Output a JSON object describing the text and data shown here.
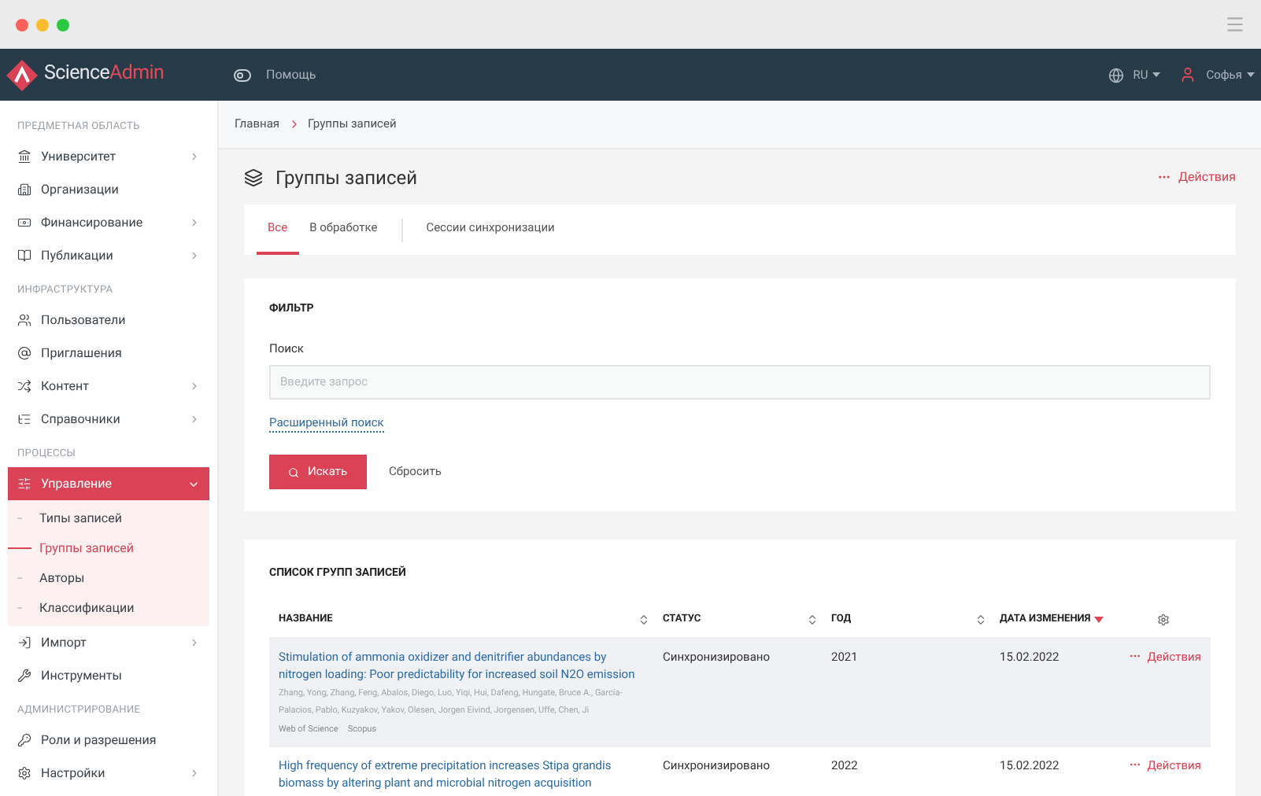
{
  "brand": {
    "name_part_1": "Science",
    "name_part_2": "Admin"
  },
  "header": {
    "help": "Помощь",
    "language": "RU",
    "user": "Софья"
  },
  "sidebar": {
    "sections": [
      {
        "title": "ПРЕДМЕТНАЯ ОБЛАСТЬ",
        "items": [
          {
            "label": "Университет",
            "has_submenu": true,
            "selected": false,
            "expanded": false
          },
          {
            "label": "Организации",
            "has_submenu": false,
            "selected": false
          },
          {
            "label": "Финансирование",
            "has_submenu": true,
            "selected": false,
            "expanded": false
          },
          {
            "label": "Публикации",
            "has_submenu": true,
            "selected": false,
            "expanded": false
          }
        ]
      },
      {
        "title": "ИНФРАСТРУКТУРА",
        "items": [
          {
            "label": "Пользователи",
            "has_submenu": false,
            "selected": false
          },
          {
            "label": "Приглашения",
            "has_submenu": false,
            "selected": false
          },
          {
            "label": "Контент",
            "has_submenu": true,
            "selected": false,
            "expanded": false
          },
          {
            "label": "Справочники",
            "has_submenu": true,
            "selected": false,
            "expanded": false
          }
        ]
      },
      {
        "title": "ПРОЦЕССЫ",
        "items": [
          {
            "label": "Управление",
            "has_submenu": true,
            "selected": true,
            "expanded": true,
            "children": [
              {
                "label": "Типы записей",
                "selected": false
              },
              {
                "label": "Группы записей",
                "selected": true
              },
              {
                "label": "Авторы",
                "selected": false
              },
              {
                "label": "Классификации",
                "selected": false
              }
            ]
          },
          {
            "label": "Импорт",
            "has_submenu": true,
            "selected": false,
            "expanded": false
          },
          {
            "label": "Инструменты",
            "has_submenu": false,
            "selected": false
          }
        ]
      },
      {
        "title": "АДМИНИСТРИРОВАНИЕ",
        "items": [
          {
            "label": "Роли и разрешения",
            "has_submenu": false,
            "selected": false
          },
          {
            "label": "Настройки",
            "has_submenu": true,
            "selected": false,
            "expanded": false
          }
        ]
      }
    ]
  },
  "breadcrumbs": [
    "Главная",
    "Группы записей"
  ],
  "page": {
    "title": "Группы записей",
    "actions": "Действия"
  },
  "tabs": [
    {
      "label": "Все",
      "selected": true
    },
    {
      "label": "В обработке",
      "selected": false
    },
    {
      "label": "Сессии синхронизации",
      "selected": false
    }
  ],
  "filter": {
    "title": "ФИЛЬТР",
    "search_label": "Поиск",
    "placeholder": "Введите запрос",
    "advanced_link": "Расширенный поиск",
    "search_button": "Искать",
    "reset_button": "Сбросить"
  },
  "table": {
    "title": "СПИСОК ГРУПП ЗАПИСЕЙ",
    "columns": [
      {
        "label": "НАЗВАНИЕ",
        "sorted": false
      },
      {
        "label": "СТАТУС",
        "sorted": false
      },
      {
        "label": "ГОД",
        "sorted": false
      },
      {
        "label": "ДАТА ИЗМЕНЕНИЯ",
        "sorted": true
      }
    ],
    "rows": [
      {
        "title": "Stimulation of ammonia oxidizer and denitrifier abundances by nitrogen loading: Poor predictability for increased soil N2O emission",
        "authors": "Zhang, Yong, Zhang, Feng, Abalos, Diego, Luo, Yiqi, Hui, Dafeng, Hungate, Bruce A., Garcia-Palacios, Pablo, Kuzyakov, Yakov, Olesen, Jorgen Eivind, Jorgensen, Uffe, Chen, Ji",
        "sources": [
          "Web of Science",
          "Scopus"
        ],
        "status": "Синхронизировано",
        "year": "2021",
        "date": "15.02.2022",
        "actions": "Действия",
        "selected": true
      },
      {
        "title": "High frequency of extreme precipitation increases Stipa grandis biomass by altering plant and microbial nitrogen acquisition",
        "status": "Синхронизировано",
        "year": "2022",
        "date": "15.02.2022",
        "actions": "Действия",
        "selected": false
      }
    ]
  }
}
